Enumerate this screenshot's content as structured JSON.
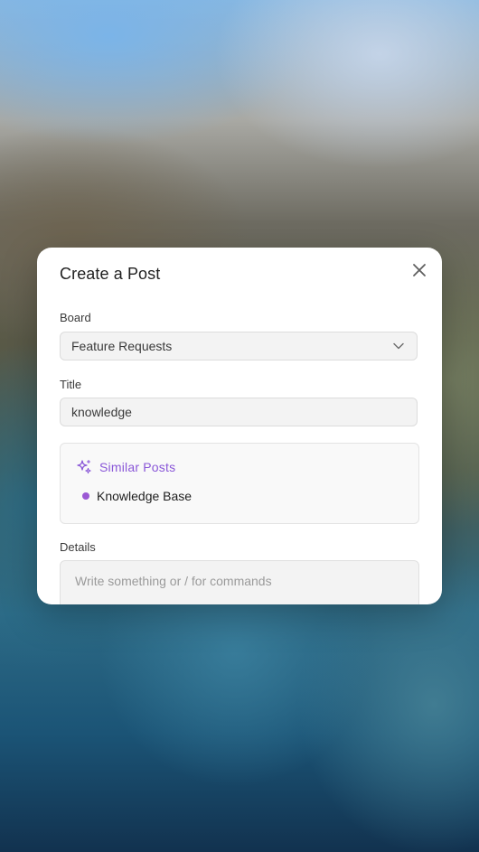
{
  "modal": {
    "title": "Create a Post",
    "close_icon": "close-icon"
  },
  "board": {
    "label": "Board",
    "selected": "Feature Requests",
    "icon": "chevron-down-icon"
  },
  "title_field": {
    "label": "Title",
    "value": "knowledge"
  },
  "similar_posts": {
    "heading": "Similar Posts",
    "icon": "sparkles-icon",
    "accent_color": "#8a57d8",
    "items": [
      {
        "label": "Knowledge Base",
        "dot_color": "#9b59d4"
      }
    ]
  },
  "details": {
    "label": "Details",
    "placeholder": "Write something or / for commands"
  }
}
